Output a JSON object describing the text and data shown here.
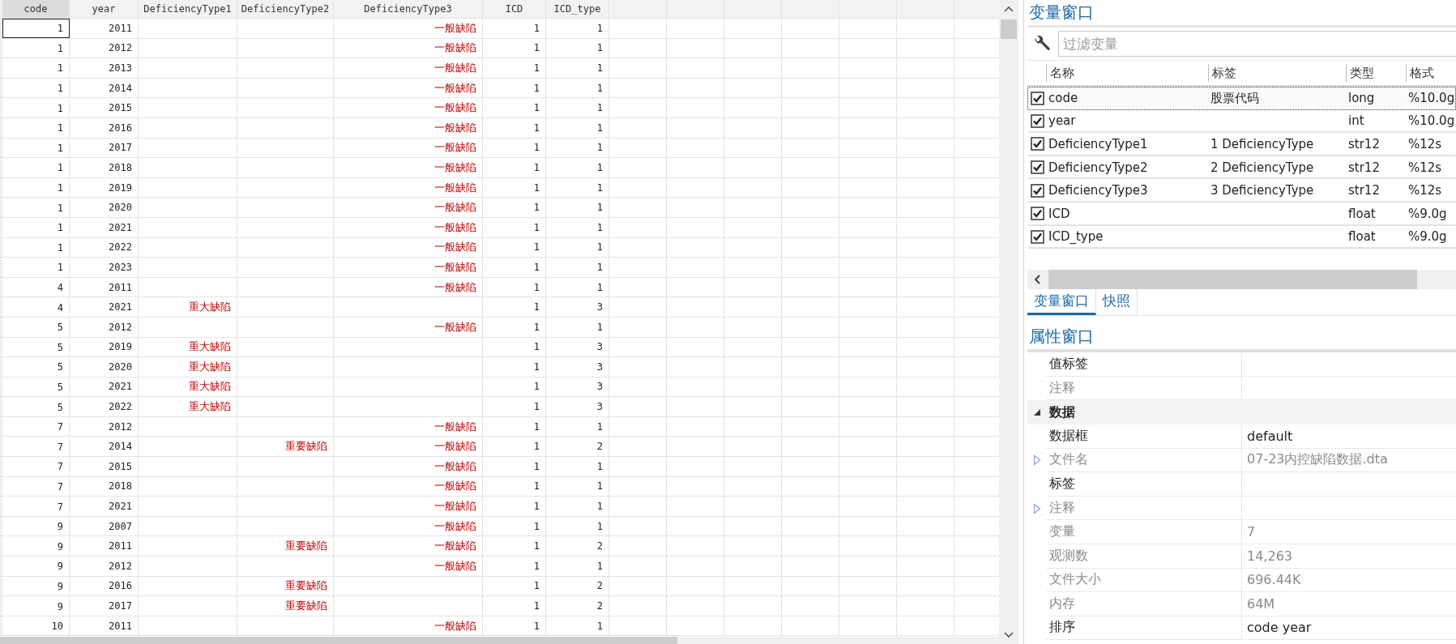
{
  "data_editor": {
    "columns": [
      {
        "label": "code",
        "selected": true
      },
      {
        "label": "year",
        "selected": false
      },
      {
        "label": "DeficiencyType1",
        "selected": false
      },
      {
        "label": "DeficiencyType2",
        "selected": false
      },
      {
        "label": "DeficiencyType3",
        "selected": false
      },
      {
        "label": "ICD",
        "selected": false
      },
      {
        "label": "ICD_type",
        "selected": false
      }
    ],
    "rows": [
      {
        "code": "1",
        "year": "2011",
        "deficiency_type3": "一般缺陷",
        "icd": "1",
        "icd_type": "1",
        "selected": true
      },
      {
        "code": "1",
        "year": "2012",
        "deficiency_type3": "一般缺陷",
        "icd": "1",
        "icd_type": "1",
        "selected": false
      },
      {
        "code": "1",
        "year": "2013",
        "deficiency_type3": "一般缺陷",
        "icd": "1",
        "icd_type": "1",
        "selected": false
      },
      {
        "code": "1",
        "year": "2014",
        "deficiency_type3": "一般缺陷",
        "icd": "1",
        "icd_type": "1",
        "selected": false
      },
      {
        "code": "1",
        "year": "2015",
        "deficiency_type3": "一般缺陷",
        "icd": "1",
        "icd_type": "1",
        "selected": false
      },
      {
        "code": "1",
        "year": "2016",
        "deficiency_type3": "一般缺陷",
        "icd": "1",
        "icd_type": "1",
        "selected": false
      },
      {
        "code": "1",
        "year": "2017",
        "deficiency_type3": "一般缺陷",
        "icd": "1",
        "icd_type": "1",
        "selected": false
      },
      {
        "code": "1",
        "year": "2018",
        "deficiency_type3": "一般缺陷",
        "icd": "1",
        "icd_type": "1",
        "selected": false
      },
      {
        "code": "1",
        "year": "2019",
        "deficiency_type3": "一般缺陷",
        "icd": "1",
        "icd_type": "1",
        "selected": false
      },
      {
        "code": "1",
        "year": "2020",
        "deficiency_type3": "一般缺陷",
        "icd": "1",
        "icd_type": "1",
        "selected": false
      },
      {
        "code": "1",
        "year": "2021",
        "deficiency_type3": "一般缺陷",
        "icd": "1",
        "icd_type": "1",
        "selected": false
      },
      {
        "code": "1",
        "year": "2022",
        "deficiency_type3": "一般缺陷",
        "icd": "1",
        "icd_type": "1",
        "selected": false
      },
      {
        "code": "1",
        "year": "2023",
        "deficiency_type3": "一般缺陷",
        "icd": "1",
        "icd_type": "1",
        "selected": false
      },
      {
        "code": "4",
        "year": "2011",
        "deficiency_type3": "一般缺陷",
        "icd": "1",
        "icd_type": "1",
        "selected": false
      },
      {
        "code": "4",
        "year": "2021",
        "deficiency_type1": "重大缺陷",
        "icd": "1",
        "icd_type": "3",
        "selected": false
      },
      {
        "code": "5",
        "year": "2012",
        "deficiency_type3": "一般缺陷",
        "icd": "1",
        "icd_type": "1",
        "selected": false
      },
      {
        "code": "5",
        "year": "2019",
        "deficiency_type1": "重大缺陷",
        "icd": "1",
        "icd_type": "3",
        "selected": false
      },
      {
        "code": "5",
        "year": "2020",
        "deficiency_type1": "重大缺陷",
        "icd": "1",
        "icd_type": "3",
        "selected": false
      },
      {
        "code": "5",
        "year": "2021",
        "deficiency_type1": "重大缺陷",
        "icd": "1",
        "icd_type": "3",
        "selected": false
      },
      {
        "code": "5",
        "year": "2022",
        "deficiency_type1": "重大缺陷",
        "icd": "1",
        "icd_type": "3",
        "selected": false
      },
      {
        "code": "7",
        "year": "2012",
        "deficiency_type3": "一般缺陷",
        "icd": "1",
        "icd_type": "1",
        "selected": false
      },
      {
        "code": "7",
        "year": "2014",
        "deficiency_type2": "重要缺陷",
        "deficiency_type3": "一般缺陷",
        "icd": "1",
        "icd_type": "2",
        "selected": false
      },
      {
        "code": "7",
        "year": "2015",
        "deficiency_type3": "一般缺陷",
        "icd": "1",
        "icd_type": "1",
        "selected": false
      },
      {
        "code": "7",
        "year": "2018",
        "deficiency_type3": "一般缺陷",
        "icd": "1",
        "icd_type": "1",
        "selected": false
      },
      {
        "code": "7",
        "year": "2021",
        "deficiency_type3": "一般缺陷",
        "icd": "1",
        "icd_type": "1",
        "selected": false
      },
      {
        "code": "9",
        "year": "2007",
        "deficiency_type3": "一般缺陷",
        "icd": "1",
        "icd_type": "1",
        "selected": false
      },
      {
        "code": "9",
        "year": "2011",
        "deficiency_type2": "重要缺陷",
        "deficiency_type3": "一般缺陷",
        "icd": "1",
        "icd_type": "2",
        "selected": false
      },
      {
        "code": "9",
        "year": "2012",
        "deficiency_type3": "一般缺陷",
        "icd": "1",
        "icd_type": "1",
        "selected": false
      },
      {
        "code": "9",
        "year": "2016",
        "deficiency_type2": "重要缺陷",
        "icd": "1",
        "icd_type": "2",
        "selected": false
      },
      {
        "code": "9",
        "year": "2017",
        "deficiency_type2": "重要缺陷",
        "icd": "1",
        "icd_type": "2",
        "selected": false
      },
      {
        "code": "10",
        "year": "2011",
        "deficiency_type3": "一般缺陷",
        "icd": "1",
        "icd_type": "1",
        "selected": false
      }
    ]
  },
  "variables_window": {
    "title": "变量窗口",
    "filter": {
      "placeholder": "过滤变量"
    },
    "columns": [
      "名称",
      "标签",
      "类型",
      "格式"
    ],
    "variables": [
      {
        "name": "code",
        "label": "股票代码",
        "type": "long",
        "format": "%10.0g",
        "checked": true,
        "selected": true
      },
      {
        "name": "year",
        "type": "int",
        "format": "%10.0g",
        "checked": true,
        "selected": false
      },
      {
        "name": "DeficiencyType1",
        "label": "1 DeficiencyType",
        "type": "str12",
        "format": "%12s",
        "checked": true,
        "selected": false
      },
      {
        "name": "DeficiencyType2",
        "label": "2 DeficiencyType",
        "type": "str12",
        "format": "%12s",
        "checked": true,
        "selected": false
      },
      {
        "name": "DeficiencyType3",
        "label": "3 DeficiencyType",
        "type": "str12",
        "format": "%12s",
        "checked": true,
        "selected": false
      },
      {
        "name": "ICD",
        "type": "float",
        "format": "%9.0g",
        "checked": true,
        "selected": false
      },
      {
        "name": "ICD_type",
        "type": "float",
        "format": "%9.0g",
        "checked": true,
        "selected": false
      }
    ],
    "tabs": [
      {
        "label": "变量窗口",
        "selected": true
      },
      {
        "label": "快照",
        "selected": false
      }
    ]
  },
  "properties_window": {
    "title": "属性窗口",
    "rows": [
      {
        "kind": "property",
        "name": "值标签",
        "disabled": false
      },
      {
        "kind": "property",
        "name": "注释",
        "disabled": true
      },
      {
        "kind": "section",
        "name": "数据",
        "expanded": true
      },
      {
        "kind": "property",
        "name": "数据框",
        "value": "default",
        "disabled": false
      },
      {
        "kind": "expandable",
        "name": "文件名",
        "value": "07-23内控缺陷数据.dta",
        "disabled": true,
        "expanded": false
      },
      {
        "kind": "property",
        "name": "标签",
        "disabled": false
      },
      {
        "kind": "expandable",
        "name": "注释",
        "disabled": true,
        "expanded": false
      },
      {
        "kind": "property",
        "name": "变量",
        "value": "7",
        "disabled": true
      },
      {
        "kind": "property",
        "name": "观测数",
        "value": "14,263",
        "disabled": true
      },
      {
        "kind": "property",
        "name": "文件大小",
        "value": "696.44K",
        "disabled": true
      },
      {
        "kind": "property",
        "name": "内存",
        "value": "64M",
        "disabled": true
      },
      {
        "kind": "property",
        "name": "排序",
        "value": "code year",
        "disabled": false
      }
    ]
  }
}
